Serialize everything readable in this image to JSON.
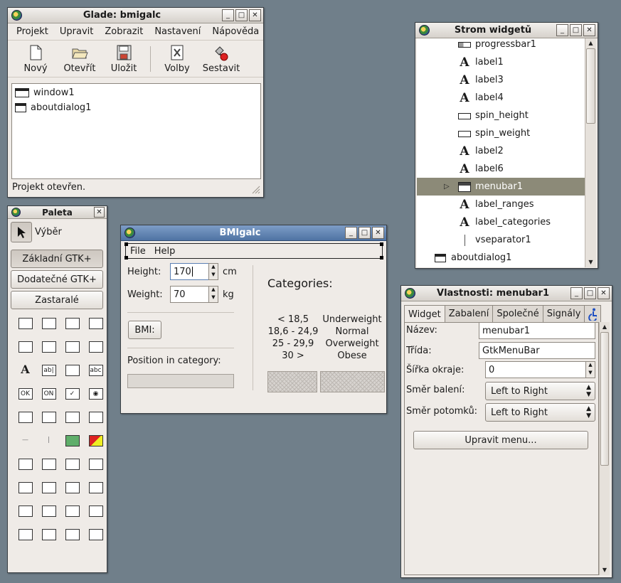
{
  "glade": {
    "title": "Glade: bmigalc",
    "menu": [
      "Projekt",
      "Upravit",
      "Zobrazit",
      "Nastavení",
      "Nápověda"
    ],
    "toolbar": [
      {
        "label": "Nový",
        "icon": "new-document-icon"
      },
      {
        "label": "Otevřít",
        "icon": "open-folder-icon"
      },
      {
        "label": "Uložit",
        "icon": "save-disk-icon"
      },
      {
        "label": "Volby",
        "icon": "preferences-icon"
      },
      {
        "label": "Sestavit",
        "icon": "build-icon"
      }
    ],
    "items": [
      "window1",
      "aboutdialog1"
    ],
    "status": "Projekt otevřen."
  },
  "paleta": {
    "title": "Paleta",
    "selector": "Výběr",
    "groups": [
      "Základní GTK+",
      "Dodatečné GTK+",
      "Zastaralé"
    ],
    "widgets": [
      "window",
      "toolbar",
      "menubar",
      "statusbar",
      "button-box",
      "check-box",
      "radio-box",
      "hbox",
      "label",
      "entry",
      "text-view",
      "text",
      "ok",
      "on",
      "check",
      "radio",
      "spin",
      "combo",
      "tree",
      "table",
      "hsep",
      "vsep",
      "image",
      "drawing",
      "dialog",
      "file-dialog",
      "color-dialog",
      "font-dialog",
      "paned",
      "vpaned",
      "table2",
      "fixed",
      "ruler",
      "vruler",
      "vscale",
      "hscale",
      "frame",
      "notebook",
      "alignment",
      "layout"
    ]
  },
  "bmi": {
    "title": "BMIgalc",
    "menu": [
      "File",
      "Help"
    ],
    "height_label": "Height:",
    "height_value": "170",
    "height_unit": "cm",
    "weight_label": "Weight:",
    "weight_value": "70",
    "weight_unit": "kg",
    "bmi_button": "BMI:",
    "position_label": "Position in category:",
    "progress": 0,
    "categories_title": "Categories:",
    "ranges": [
      "< 18,5",
      "18,6 - 24,9",
      "25 - 29,9",
      "30 >"
    ],
    "categories": [
      "Underweight",
      "Normal",
      "Overweight",
      "Obese"
    ]
  },
  "strom": {
    "title": "Strom widgetů",
    "rows": [
      {
        "label": "progressbar1",
        "icon": "progressbar-icon"
      },
      {
        "label": "label1",
        "icon": "label-icon"
      },
      {
        "label": "label3",
        "icon": "label-icon"
      },
      {
        "label": "label4",
        "icon": "label-icon"
      },
      {
        "label": "spin_height",
        "icon": "spin-icon"
      },
      {
        "label": "spin_weight",
        "icon": "spin-icon"
      },
      {
        "label": "label2",
        "icon": "label-icon"
      },
      {
        "label": "label6",
        "icon": "label-icon"
      },
      {
        "label": "menubar1",
        "icon": "menubar-icon"
      },
      {
        "label": "label_ranges",
        "icon": "label-icon"
      },
      {
        "label": "label_categories",
        "icon": "label-icon"
      },
      {
        "label": "vseparator1",
        "icon": "vseparator-icon"
      },
      {
        "label": "aboutdialog1",
        "icon": "aboutdialog-icon"
      }
    ]
  },
  "vlastnosti": {
    "title": "Vlastnosti: menubar1",
    "tabs": [
      "Widget",
      "Zabalení",
      "Společné",
      "Signály"
    ],
    "nazev_label": "Název:",
    "nazev_value": "menubar1",
    "trida_label": "Třída:",
    "trida_value": "GtkMenuBar",
    "sirka_label": "Šířka okraje:",
    "sirka_value": "0",
    "smer_baleni_label": "Směr balení:",
    "smer_baleni_value": "Left to Right",
    "smer_potomku_label": "Směr potomků:",
    "smer_potomku_value": "Left to Right",
    "edit_menu_button": "Upravit menu..."
  }
}
